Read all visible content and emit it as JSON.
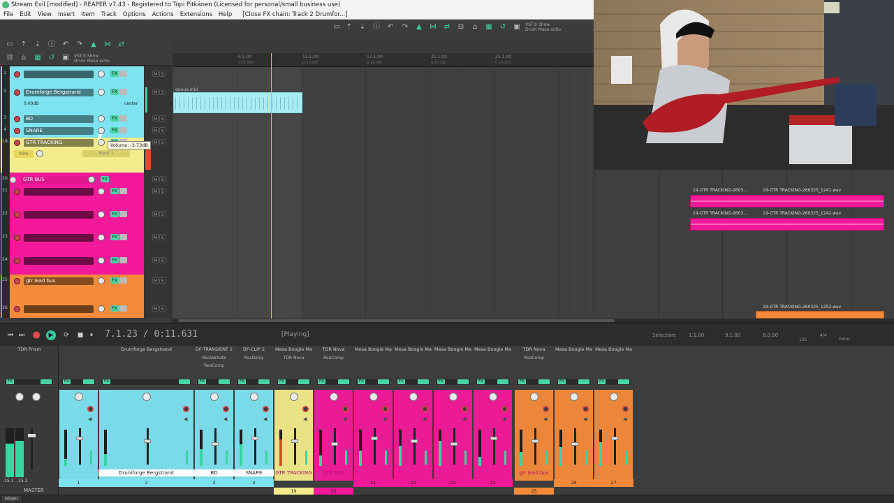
{
  "window": {
    "title": "Stream Evil [modified] - REAPER v7.43 - Registered to Topi Pitkänen (Licensed for personal/small business use)"
  },
  "menu": [
    "File",
    "Edit",
    "View",
    "Insert",
    "Item",
    "Track",
    "Options",
    "Actions",
    "Extensions",
    "Help",
    "[Close FX chain: Track 2 Drumfor...]"
  ],
  "toolbar": {
    "vst_label_top": "VST3i Show",
    "vst_label_bottom": "Drum Mesa actio",
    "tcp_vst_top": "VST3i Show",
    "tcp_vst_bottom": "Drum Mesa actio"
  },
  "ruler": {
    "bars": [
      "9.1.00",
      "13.1.00",
      "17.1.00",
      "21.1.00",
      "25.1.00"
    ],
    "times": [
      "0:07.880",
      "0:11.960",
      "0:16.040",
      "0:20.120",
      "0:24.200"
    ]
  },
  "tracks": [
    {
      "num": "1",
      "name": "",
      "color": "#7ee3f0"
    },
    {
      "num": "2",
      "name": "Drumforge Bergstrand",
      "volume": "0.00dB",
      "pan": "center",
      "color": "#7ee3f0"
    },
    {
      "num": "3",
      "name": "BD",
      "color": "#7ee3f0"
    },
    {
      "num": "4",
      "name": "SNARE",
      "color": "#7ee3f0"
    },
    {
      "num": "19",
      "name": "GTR TRACKING",
      "color": "#f2ec8a",
      "input": "Input 1"
    },
    {
      "num": "20",
      "name": "GTR BUS",
      "color": "#f4199a"
    },
    {
      "num": "21",
      "name": "",
      "color": "#f4199a"
    },
    {
      "num": "22",
      "name": "",
      "color": "#f4199a"
    },
    {
      "num": "23",
      "name": "",
      "color": "#f4199a"
    },
    {
      "num": "24",
      "name": "",
      "color": "#f4199a"
    },
    {
      "num": "25",
      "name": "gtr lead bus",
      "color": "#f48a3a"
    },
    {
      "num": "26",
      "name": "",
      "color": "#f48a3a"
    }
  ],
  "tooltip": "Volume: -3.73dB",
  "midi_item": {
    "name": "queue.mid"
  },
  "items_right": [
    {
      "label_a": "19-GTR TRACKING-2603...",
      "label_b": "19-GTR TRACKING-260325_1241.wav"
    },
    {
      "label_a": "19-GTR TRACKING-2603...",
      "label_b": "19-GTR TRACKING-260325_1242.wav"
    },
    {
      "label_b": "19-GTR TRACKING-260325_1252.wav"
    }
  ],
  "transport": {
    "time": "7.1.23 / 0:11.631",
    "state": "[Playing]",
    "selection_label": "Selection:",
    "sel_start": "1.1.00",
    "sel_end": "9.1.00",
    "sel_len": "8.0.00",
    "bpm": "125",
    "sig": "4/4",
    "rate": "none"
  },
  "mixer": {
    "master": {
      "name": "TDR Prism",
      "label": "MASTER",
      "peak_l": "-15.1",
      "peak_r": "-15.3"
    },
    "strips": [
      {
        "name": "",
        "fx1": "",
        "fx2": "",
        "label": "",
        "num": "1",
        "color": "#7ee3f0"
      },
      {
        "name": "Drumforge Bergstrand",
        "fx1": "",
        "fx2": "",
        "label": "Drumforge Bergstrand",
        "num": "2",
        "color": "#7ee3f0"
      },
      {
        "name": "DF-TRANSIENT 2",
        "fx1": "ReaVerbate",
        "fx2": "ReaComp",
        "label": "BD",
        "num": "3",
        "color": "#7ee3f0"
      },
      {
        "name": "DF-CLIP 2",
        "fx1": "ReaDelay",
        "fx2": "",
        "label": "SNARE",
        "num": "4",
        "color": "#7ee3f0"
      },
      {
        "name": "Mesa Boogie Ma",
        "fx1": "TDR Nova",
        "fx2": "",
        "label": "GTR TRACKING",
        "num": "19",
        "color": "#f2ec8a"
      },
      {
        "name": "TDR Nova",
        "fx1": "ReaComp",
        "fx2": "",
        "label": "GTR BUS",
        "num": "20",
        "color": "#f4199a"
      },
      {
        "name": "Mesa Boogie Ma",
        "fx1": "",
        "fx2": "",
        "label": "",
        "num": "21",
        "color": "#f4199a"
      },
      {
        "name": "Mesa Boogie Ma",
        "fx1": "",
        "fx2": "",
        "label": "",
        "num": "22",
        "color": "#f4199a"
      },
      {
        "name": "Mesa Boogie Ma",
        "fx1": "",
        "fx2": "",
        "label": "",
        "num": "23",
        "color": "#f4199a"
      },
      {
        "name": "Mesa Boogie Ma",
        "fx1": "",
        "fx2": "",
        "label": "",
        "num": "24",
        "color": "#f4199a"
      },
      {
        "name": "TDR Nova",
        "fx1": "ReaComp",
        "fx2": "",
        "label": "gtr lead bus",
        "num": "25",
        "color": "#f48a3a"
      },
      {
        "name": "Mesa Boogie Ma",
        "fx1": "",
        "fx2": "",
        "label": "",
        "num": "26",
        "color": "#f48a3a"
      },
      {
        "name": "Mesa Boogie Ma",
        "fx1": "",
        "fx2": "",
        "label": "",
        "num": "27",
        "color": "#f48a3a"
      }
    ]
  },
  "mixer_tab": "Mixer",
  "icons": {
    "play": "play-icon",
    "record": "record-icon",
    "stop": "stop-icon",
    "pause": "pause-icon",
    "loop": "loop-icon"
  }
}
